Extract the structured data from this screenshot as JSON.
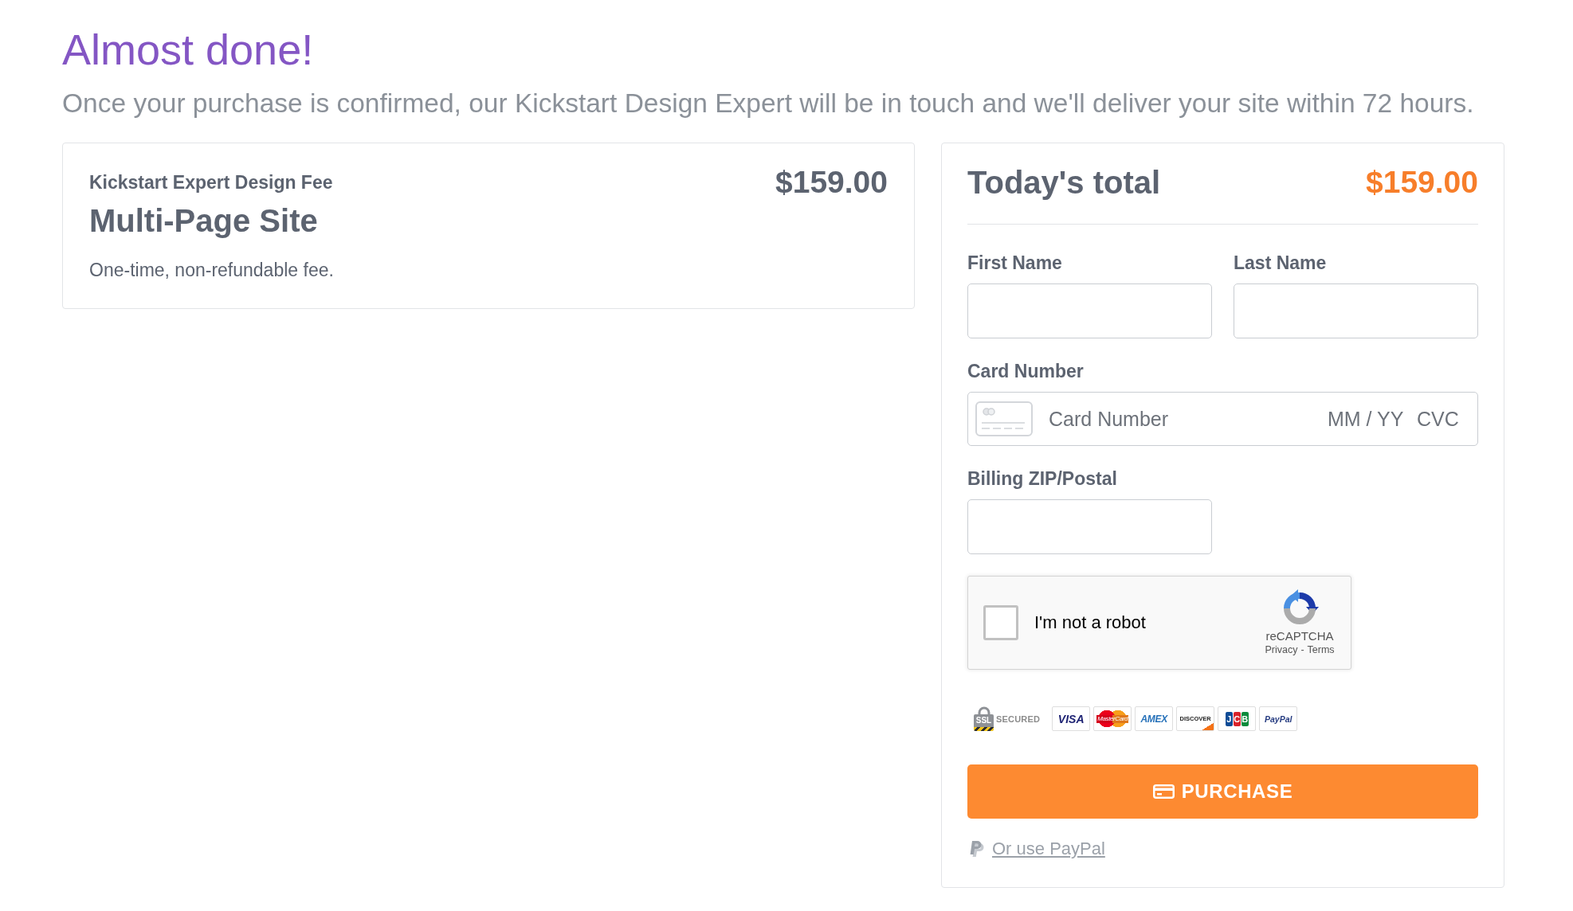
{
  "header": {
    "title": "Almost done!",
    "subtitle": "Once your purchase is confirmed, our Kickstart Design Expert will be in touch and we'll deliver your site within 72 hours."
  },
  "order": {
    "category": "Kickstart Expert Design Fee",
    "product": "Multi-Page Site",
    "note": "One-time, non-refundable fee.",
    "price": "$159.00"
  },
  "checkout": {
    "total_label": "Today's total",
    "total": "$159.00",
    "fields": [
      {
        "kind": "text",
        "label": "First Name"
      },
      {
        "kind": "text",
        "label": "Last Name"
      },
      {
        "kind": "card",
        "label": "Card Number",
        "placeholder": "Card Number",
        "expiry_placeholder": "MM / YY",
        "cvc_placeholder": "CVC"
      },
      {
        "kind": "text",
        "label": "Billing ZIP/Postal"
      }
    ],
    "captcha": {
      "checked": false,
      "label": "I'm not a robot",
      "brand": "reCAPTCHA",
      "privacy_link": "Privacy",
      "separator": "-",
      "terms_link": "Terms"
    },
    "security_seal": {
      "lock_text": "SSL",
      "label": "SECURED"
    },
    "payment_logos": [
      {
        "kind": "visa",
        "text": "VISA"
      },
      {
        "kind": "mastercard",
        "text": "MasterCard"
      },
      {
        "kind": "amex",
        "text": "AMEX"
      },
      {
        "kind": "discover",
        "text": "DISCOVER"
      },
      {
        "kind": "jcb",
        "text": "JCB"
      },
      {
        "kind": "paypal",
        "text": "PayPal"
      }
    ],
    "purchase_button": "PURCHASE",
    "paypal_link": "Or use PayPal"
  }
}
